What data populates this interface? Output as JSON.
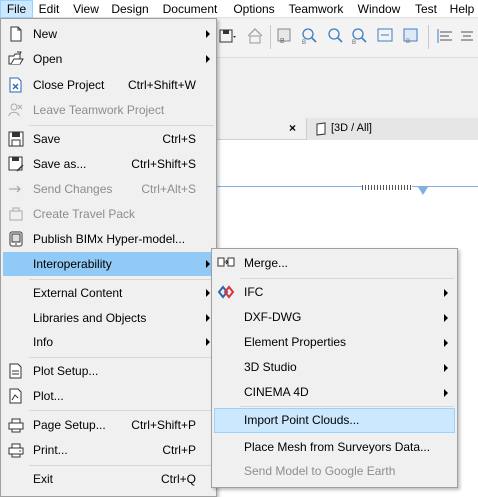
{
  "menubar": {
    "items": [
      "File",
      "Edit",
      "View",
      "Design",
      "Document",
      "Options",
      "Teamwork",
      "Window",
      "Test",
      "Help"
    ]
  },
  "tabs": {
    "close_glyph": "×",
    "view_3d_label": "[3D / All]"
  },
  "file_menu": {
    "items": [
      {
        "label": "New",
        "shortcut": "",
        "icon": "new-file-icon",
        "submenu": true
      },
      {
        "label": "Open",
        "shortcut": "",
        "icon": "open-folder-icon",
        "submenu": true
      },
      {
        "label": "Close Project",
        "shortcut": "Ctrl+Shift+W",
        "icon": "close-project-icon"
      },
      {
        "label": "Leave Teamwork Project",
        "shortcut": "",
        "icon": "leave-teamwork-icon",
        "disabled": true
      },
      {
        "label": "Save",
        "shortcut": "Ctrl+S",
        "icon": "save-icon"
      },
      {
        "label": "Save as...",
        "shortcut": "Ctrl+Shift+S",
        "icon": "save-as-icon"
      },
      {
        "label": "Send Changes",
        "shortcut": "Ctrl+Alt+S",
        "icon": "send-changes-icon",
        "disabled": true
      },
      {
        "label": "Create Travel Pack",
        "shortcut": "",
        "icon": "travel-pack-icon",
        "disabled": true
      },
      {
        "label": "Publish BIMx Hyper-model...",
        "shortcut": "",
        "icon": "bimx-icon"
      },
      {
        "label": "Interoperability",
        "shortcut": "",
        "submenu": true,
        "selected": true
      },
      {
        "label": "External Content",
        "shortcut": "",
        "submenu": true
      },
      {
        "label": "Libraries and Objects",
        "shortcut": "",
        "submenu": true
      },
      {
        "label": "Info",
        "shortcut": "",
        "submenu": true
      },
      {
        "label": "Plot Setup...",
        "shortcut": "",
        "icon": "plot-setup-icon"
      },
      {
        "label": "Plot...",
        "shortcut": "",
        "icon": "plot-icon"
      },
      {
        "label": "Page Setup...",
        "shortcut": "Ctrl+Shift+P",
        "icon": "page-setup-icon"
      },
      {
        "label": "Print...",
        "shortcut": "Ctrl+P",
        "icon": "print-icon"
      },
      {
        "label": "Exit",
        "shortcut": "Ctrl+Q"
      }
    ]
  },
  "interop_submenu": {
    "items": [
      {
        "label": "Merge...",
        "icon": "merge-icon"
      },
      {
        "label": "IFC",
        "icon": "ifc-icon",
        "submenu": true
      },
      {
        "label": "DXF-DWG",
        "submenu": true
      },
      {
        "label": "Element Properties",
        "submenu": true
      },
      {
        "label": "3D Studio",
        "submenu": true
      },
      {
        "label": "CINEMA 4D",
        "submenu": true
      },
      {
        "label": "Import Point Clouds...",
        "selected": true
      },
      {
        "label": "Place Mesh from Surveyors Data..."
      },
      {
        "label": "Send Model to Google Earth",
        "disabled": true
      }
    ]
  },
  "colors": {
    "menu_bg": "#f0f0f0",
    "selected_item": "#91c9f7",
    "hover_item": "#cce8ff",
    "disabled_text": "#8d8d8d"
  }
}
